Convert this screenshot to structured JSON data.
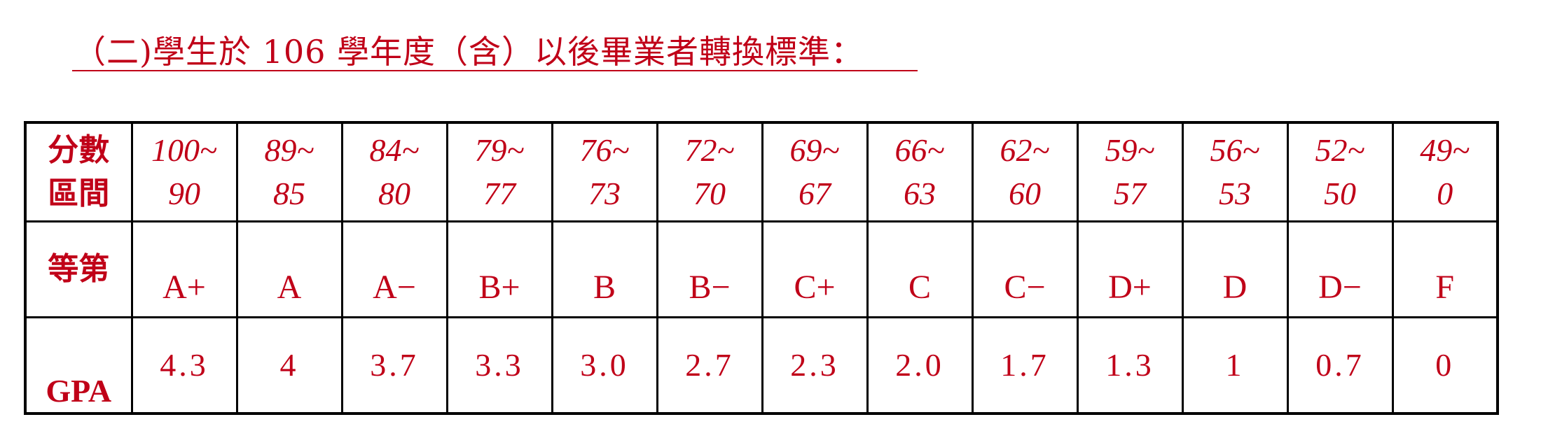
{
  "heading": "（二)學生於 106 學年度（含）以後畢業者轉換標準：",
  "table": {
    "range_label": [
      "分數",
      "區間"
    ],
    "grade_label": "等第",
    "gpa_label": "GPA",
    "columns": [
      {
        "range_top": "100~",
        "range_bottom": "90",
        "grade": "A+",
        "gpa": "4.3"
      },
      {
        "range_top": "89~",
        "range_bottom": "85",
        "grade": "A",
        "gpa": "4"
      },
      {
        "range_top": "84~",
        "range_bottom": "80",
        "grade": "A−",
        "gpa": "3.7"
      },
      {
        "range_top": "79~",
        "range_bottom": "77",
        "grade": "B+",
        "gpa": "3.3"
      },
      {
        "range_top": "76~",
        "range_bottom": "73",
        "grade": "B",
        "gpa": "3.0"
      },
      {
        "range_top": "72~",
        "range_bottom": "70",
        "grade": "B−",
        "gpa": "2.7"
      },
      {
        "range_top": "69~",
        "range_bottom": "67",
        "grade": "C+",
        "gpa": "2.3"
      },
      {
        "range_top": "66~",
        "range_bottom": "63",
        "grade": "C",
        "gpa": "2.0"
      },
      {
        "range_top": "62~",
        "range_bottom": "60",
        "grade": "C−",
        "gpa": "1.7"
      },
      {
        "range_top": "59~",
        "range_bottom": "57",
        "grade": "D+",
        "gpa": "1.3"
      },
      {
        "range_top": "56~",
        "range_bottom": "53",
        "grade": "D",
        "gpa": "1"
      },
      {
        "range_top": "52~",
        "range_bottom": "50",
        "grade": "D−",
        "gpa": "0.7"
      },
      {
        "range_top": "49~",
        "range_bottom": "0",
        "grade": "F",
        "gpa": "0"
      }
    ]
  },
  "colors": {
    "text": "#c00018",
    "border": "#000000"
  }
}
